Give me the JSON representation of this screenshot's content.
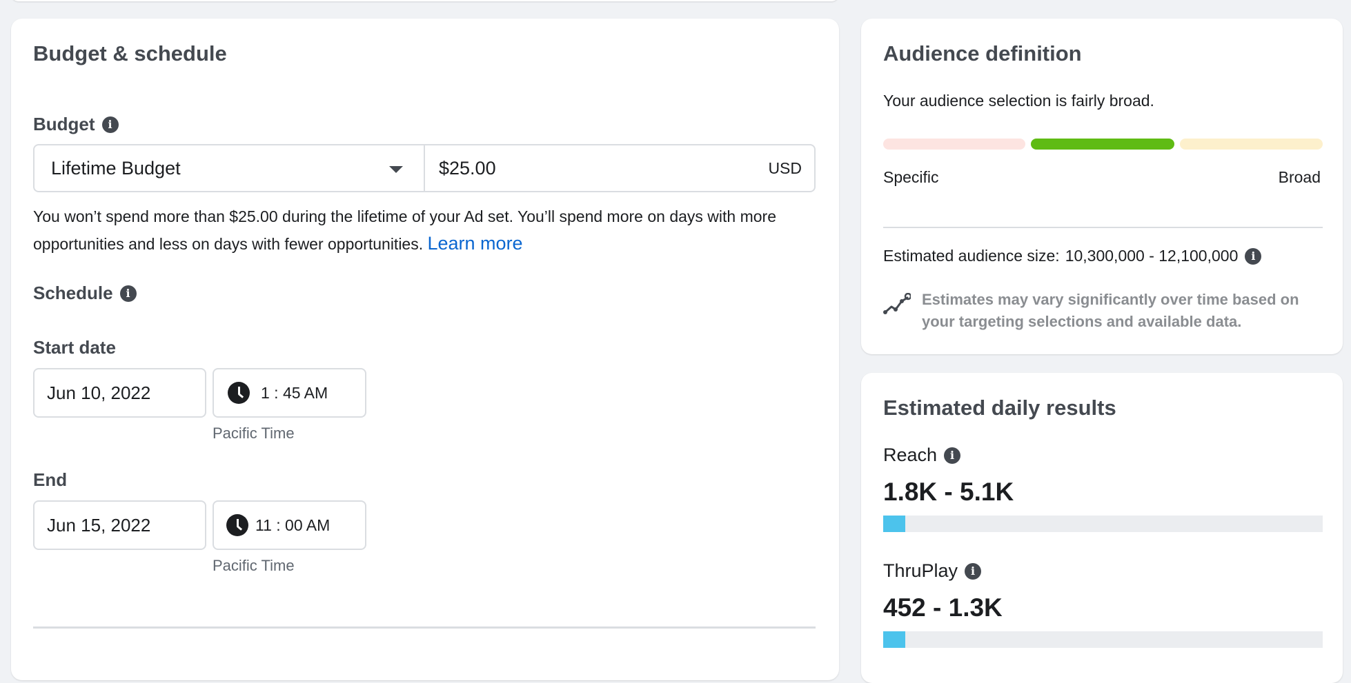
{
  "budget_schedule": {
    "title": "Budget & schedule",
    "budget_label": "Budget",
    "budget_type": "Lifetime Budget",
    "budget_amount": "$25.00",
    "currency": "USD",
    "help_text": "You won’t spend more than $25.00 during the lifetime of your Ad set. You’ll spend more on days with more opportunities and less on days with fewer opportunities.",
    "learn_more": "Learn more",
    "schedule_label": "Schedule",
    "start": {
      "label": "Start date",
      "date": "Jun 10, 2022",
      "time": "1 : 45 AM",
      "timezone": "Pacific Time"
    },
    "end": {
      "label": "End",
      "date": "Jun 15, 2022",
      "time": "11 : 00 AM",
      "timezone": "Pacific Time"
    }
  },
  "audience": {
    "title": "Audience definition",
    "description": "Your audience selection is fairly broad.",
    "meter_colors": [
      "#fde4e1",
      "#5fbb14",
      "#fdf0cc"
    ],
    "meter_active_segment": 2,
    "specific_label": "Specific",
    "broad_label": "Broad",
    "size_label": "Estimated audience size:",
    "size_value": "10,300,000 - 12,100,000",
    "note": "Estimates may vary significantly over time based on your targeting selections and available data."
  },
  "results": {
    "title": "Estimated daily results",
    "metrics": [
      {
        "label": "Reach",
        "value": "1.8K - 5.1K",
        "fill_fraction": 0.05
      },
      {
        "label": "ThruPlay",
        "value": "452 - 1.3K",
        "fill_fraction": 0.05
      }
    ],
    "accent": "#4cc3ec"
  }
}
